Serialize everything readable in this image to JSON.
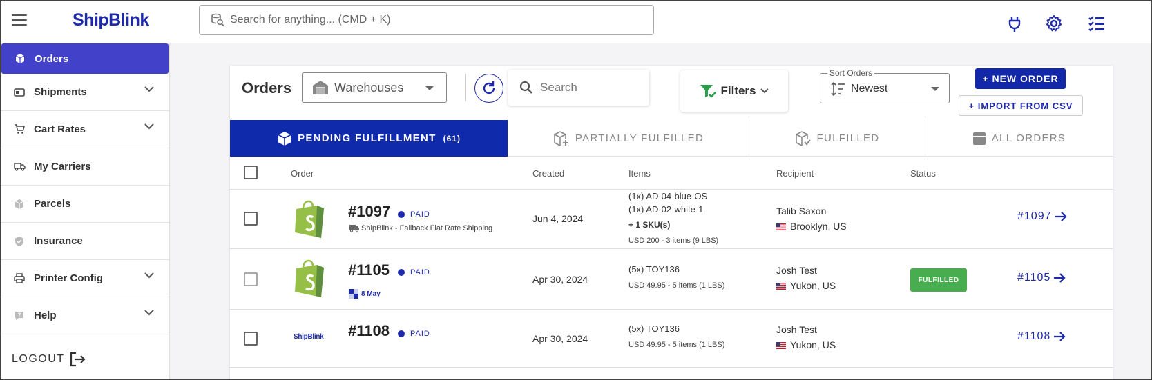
{
  "header": {
    "logo": "ShipBlink",
    "search_placeholder": "Search for anything... (CMD + K)"
  },
  "sidebar": {
    "items": [
      {
        "label": "Orders",
        "icon": "box-icon",
        "active": true
      },
      {
        "label": "Shipments",
        "icon": "shipment-icon",
        "expandable": true
      },
      {
        "label": "Cart Rates",
        "icon": "cart-icon",
        "expandable": true
      },
      {
        "label": "My Carriers",
        "icon": "truck-icon"
      },
      {
        "label": "Parcels",
        "icon": "parcels-icon"
      },
      {
        "label": "Insurance",
        "icon": "shield-icon"
      },
      {
        "label": "Printer Config",
        "icon": "printer-icon",
        "expandable": true
      },
      {
        "label": "Help",
        "icon": "help-icon",
        "expandable": true
      }
    ],
    "logout": "LOGOUT"
  },
  "toolbar": {
    "title": "Orders",
    "warehouses": "Warehouses",
    "search_placeholder": "Search",
    "filters": "Filters",
    "sort_label": "Sort Orders",
    "sort_value": "Newest",
    "new_order": "+ NEW ORDER",
    "import_csv": "+ IMPORT FROM CSV"
  },
  "tabs": [
    {
      "label": "PENDING FULFILLMENT",
      "count": "(61)",
      "active": true
    },
    {
      "label": "PARTIALLY FULFILLED"
    },
    {
      "label": "FULFILLED"
    },
    {
      "label": "ALL ORDERS"
    }
  ],
  "table": {
    "columns": [
      "Order",
      "Created",
      "Items",
      "Recipient",
      "Status"
    ],
    "rows": [
      {
        "order": "#1097",
        "payment": "PAID",
        "shipping": "ShipBlink - Fallback Flat Rate Shipping",
        "created": "Jun 4, 2024",
        "items": [
          "(1x) AD-04-blue-OS",
          "(1x) AD-02-white-1"
        ],
        "more_skus": "+ 1 SKU(s)",
        "summary": "USD 200 - 3 items (9 LBS)",
        "recipient": "Talib Saxon",
        "location": "Brooklyn, US",
        "status": "",
        "link": "#1097"
      },
      {
        "order": "#1105",
        "payment": "PAID",
        "date_tag": "8 May",
        "created": "Apr 30, 2024",
        "items": [
          "(5x) TOY136"
        ],
        "summary": "USD 49.95 - 5 items (1 LBS)",
        "recipient": "Josh Test",
        "location": "Yukon, US",
        "status": "FULFILLED",
        "link": "#1105"
      },
      {
        "order": "#1108",
        "payment": "PAID",
        "source_logo": "ShipBlink",
        "created": "Apr 30, 2024",
        "items": [
          "(5x) TOY136"
        ],
        "summary": "USD 49.95 - 5 items (1 LBS)",
        "recipient": "Josh Test",
        "location": "Yukon, US",
        "status": "",
        "link": "#1108"
      }
    ]
  },
  "colors": {
    "brand": "#1d2aa9",
    "active_nav": "#4141c9",
    "fulfilled": "#47ad4f",
    "shopify_green": "#95bf47"
  }
}
